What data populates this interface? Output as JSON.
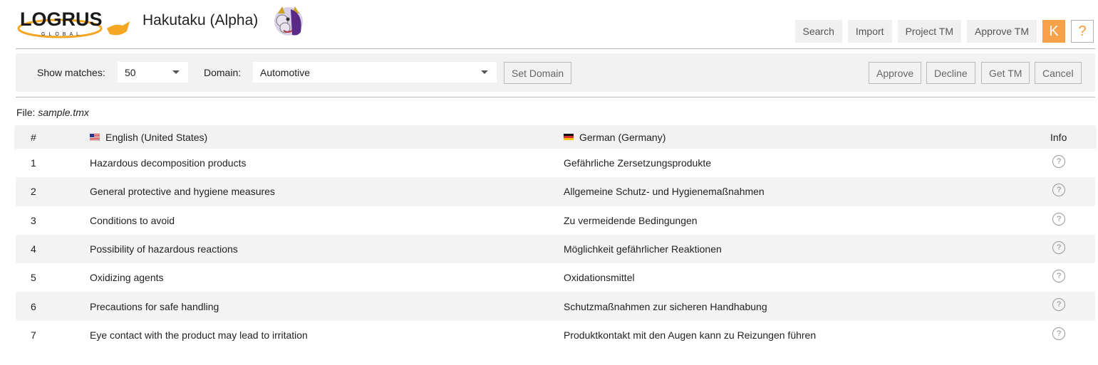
{
  "header": {
    "logo_text": "LOGRUS",
    "logo_subtext": "GLOBAL",
    "app_title": "Hakutaku (Alpha)",
    "nav": [
      {
        "label": "Search"
      },
      {
        "label": "Import"
      },
      {
        "label": "Project TM"
      },
      {
        "label": "Approve TM"
      }
    ],
    "avatar_letter": "K",
    "help_label": "?"
  },
  "toolbar": {
    "show_matches_label": "Show matches:",
    "show_matches_value": "50",
    "domain_label": "Domain:",
    "domain_value": "Automotive",
    "set_domain_label": "Set Domain",
    "approve_label": "Approve",
    "decline_label": "Decline",
    "get_tm_label": "Get TM",
    "cancel_label": "Cancel"
  },
  "file": {
    "label": "File:",
    "name": "sample.tmx"
  },
  "table": {
    "headers": {
      "num": "#",
      "source": "English (United States)",
      "target": "German (Germany)",
      "info": "Info"
    },
    "rows": [
      {
        "num": "1",
        "source": "Hazardous decomposition products",
        "target": "Gefährliche Zersetzungsprodukte"
      },
      {
        "num": "2",
        "source": "General protective and hygiene measures",
        "target": "Allgemeine Schutz- und Hygienemaßnahmen"
      },
      {
        "num": "3",
        "source": "Conditions to avoid",
        "target": "Zu vermeidende Bedingungen"
      },
      {
        "num": "4",
        "source": "Possibility of hazardous reactions",
        "target": "Möglichkeit gefährlicher Reaktionen"
      },
      {
        "num": "5",
        "source": "Oxidizing agents",
        "target": "Oxidationsmittel"
      },
      {
        "num": "6",
        "source": "Precautions for safe handling",
        "target": "Schutzmaßnahmen zur sicheren Handhabung"
      },
      {
        "num": "7",
        "source": "Eye contact with the product may lead to irritation",
        "target": "Produktkontakt mit den Augen kann zu Reizungen führen"
      }
    ],
    "info_icon": "?"
  },
  "colors": {
    "accent_orange": "#f7a24a",
    "help_orange": "#f39c33",
    "toolbar_bg": "#f2f2f2"
  }
}
